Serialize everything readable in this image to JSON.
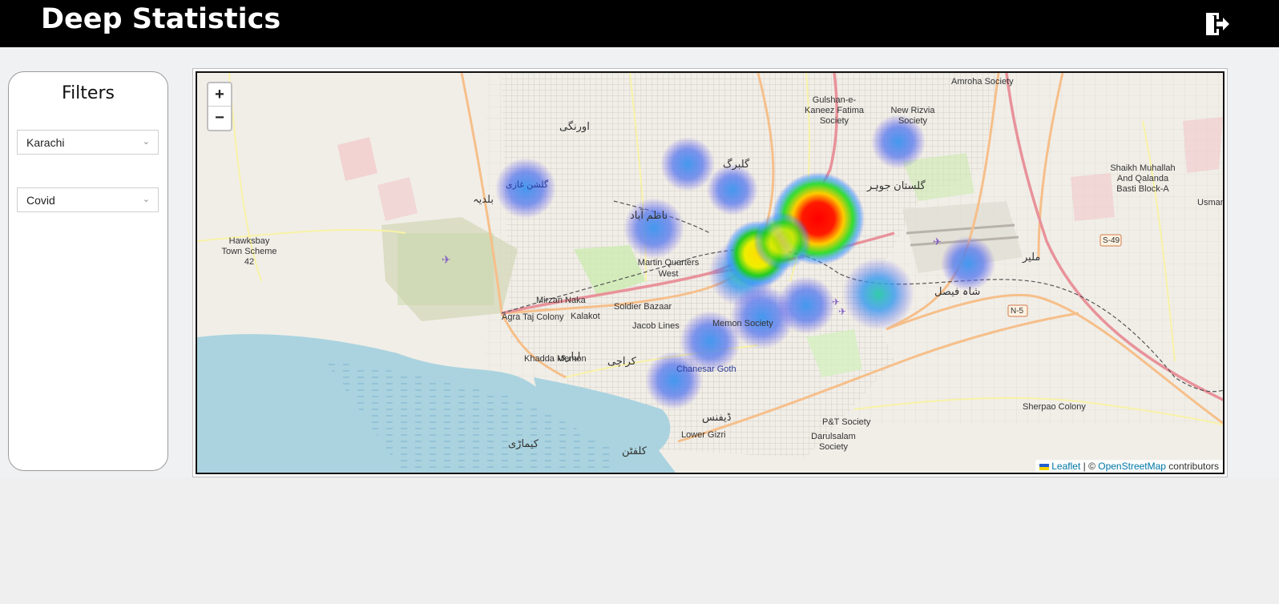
{
  "header": {
    "title": "Deep Statistics",
    "logout_icon": "logout-icon"
  },
  "filters": {
    "title": "Filters",
    "city": "Karachi",
    "dataset": "Covid"
  },
  "map": {
    "zoom_in": "+",
    "zoom_out": "−",
    "attribution": {
      "leaflet": "Leaflet",
      "separator": " | © ",
      "osm": "OpenStreetMap",
      "suffix": " contributors"
    },
    "labels": [
      "Hawksbay Town Scheme 42",
      "Martin Quarters West",
      "Mirzan Naka",
      "Soldier Bazaar",
      "Agra Taj Colony",
      "Kalakot",
      "Jacob Lines",
      "Memon Society",
      "Khadda Memon",
      "Chanesar Goth",
      "Lower Gizri",
      "P&T Society",
      "Darulsalam Society",
      "Sherpao Colony",
      "Amroha Society",
      "New Rizvia Society",
      "Gulshan-e-Kaneez Fatima Society",
      "Shaikh Muhallah And Qalanda Basti Block-A",
      "Usman",
      "S-49",
      "N-5",
      "کراچی",
      "گلبرگ",
      "ناظم آباد",
      "گلستان جوہر",
      "شاہ فیصل",
      "ملیر",
      "ڈیفنس",
      "کلفٹن",
      "کیماڑی",
      "بلدیہ",
      "گلشن غازی",
      "اورنگی",
      "لیاری"
    ]
  }
}
